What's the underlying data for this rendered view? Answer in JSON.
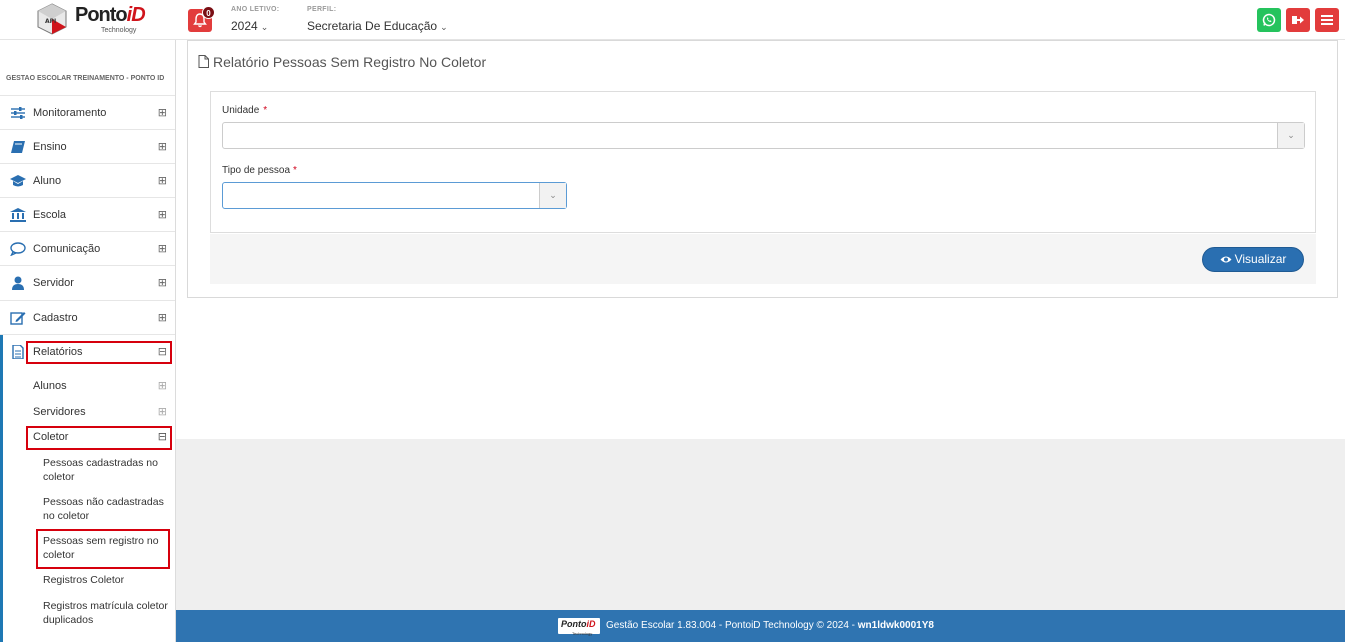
{
  "brand": {
    "name_main": "Ponto",
    "name_accent": "iD",
    "sub": "Technology"
  },
  "topbar": {
    "notifications": "0",
    "ano_label": "ANO LETIVO:",
    "ano_value": "2024",
    "perfil_label": "PERFIL:",
    "perfil_value": "Secretaria De Educação",
    "whatsapp_color": "#25c35d",
    "exit_color": "#e23c3c",
    "menu_color": "#e23c3c"
  },
  "sidebar": {
    "org": "GESTAO ESCOLAR TREINAMENTO - PONTO ID",
    "items": [
      {
        "label": "Monitoramento",
        "icon": "sliders-icon",
        "exp": "⊞"
      },
      {
        "label": "Ensino",
        "icon": "book-icon",
        "exp": "⊞"
      },
      {
        "label": "Aluno",
        "icon": "graduation-cap-icon",
        "exp": "⊞"
      },
      {
        "label": "Escola",
        "icon": "bank-icon",
        "exp": "⊞"
      },
      {
        "label": "Comunicação",
        "icon": "chat-bubble-icon",
        "exp": "⊞"
      },
      {
        "label": "Servidor",
        "icon": "user-icon",
        "exp": "⊞"
      },
      {
        "label": "Cadastro",
        "icon": "edit-icon",
        "exp": "⊞"
      },
      {
        "label": "Relatórios",
        "icon": "file-text-icon",
        "exp": "⊟"
      }
    ],
    "sub_alunos": "Alunos",
    "sub_servidores": "Servidores",
    "sub_coletor": "Coletor",
    "coletor_items": [
      "Pessoas cadastradas no coletor",
      "Pessoas não cadastradas no coletor",
      "Pessoas sem registro no coletor",
      "Registros Coletor",
      "Registros matrícula coletor duplicados"
    ]
  },
  "main": {
    "title": "Relatório Pessoas Sem Registro No Coletor",
    "unidade_label": "Unidade",
    "tipo_label": "Tipo de pessoa",
    "required_mark": "*",
    "visualizar": "Visualizar"
  },
  "footer": {
    "text": "Gestão Escolar 1.83.004 - PontoiD Technology © 2024 - ",
    "code": "wn1ldwk0001Y8"
  }
}
